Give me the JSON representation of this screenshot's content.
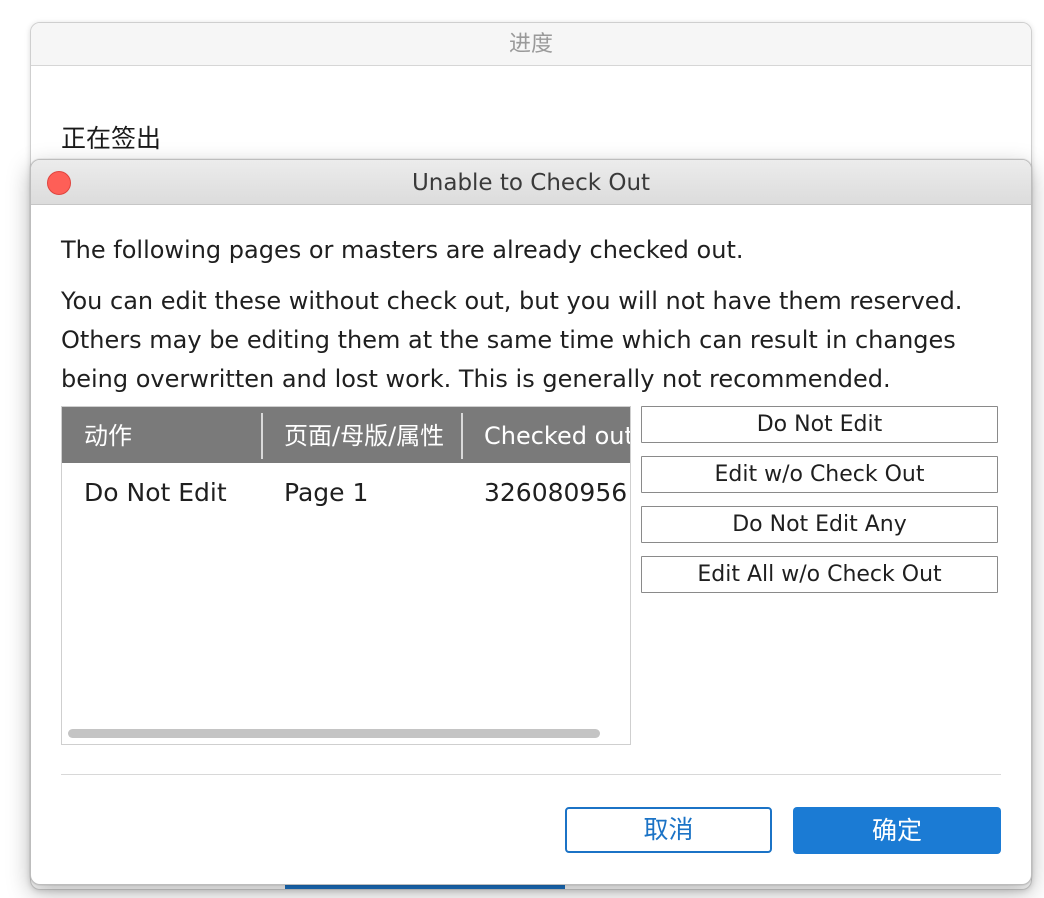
{
  "progress_window": {
    "title": "进度",
    "status": "正在签出"
  },
  "dialog": {
    "title": "Unable to Check Out",
    "message_primary": "The following pages or masters are already checked out.",
    "message_secondary": "You can edit these without check out, but you will not have them reserved. Others may be editing them at the same time which can result in changes being overwritten and lost work. This is generally not recommended.",
    "table": {
      "columns": [
        "动作",
        "页面/母版/属性",
        "Checked out"
      ],
      "rows": [
        {
          "action": "Do Not Edit",
          "item": "Page 1",
          "checked_out_by": "326080956"
        }
      ]
    },
    "side_buttons": {
      "do_not_edit": "Do Not Edit",
      "edit_without_checkout": "Edit w/o Check Out",
      "do_not_edit_any": "Do Not Edit Any",
      "edit_all_without_checkout": "Edit All w/o Check Out"
    },
    "footer": {
      "cancel_label": "取消",
      "ok_label": "确定"
    }
  },
  "colors": {
    "accent": "#1b7bd4",
    "table_header": "#7a7a7a",
    "close_button": "#fe5f57"
  }
}
